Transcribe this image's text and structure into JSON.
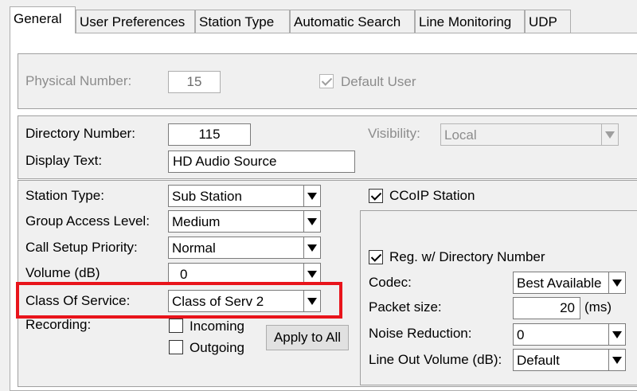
{
  "tabs": [
    "General",
    "User Preferences",
    "Station Type",
    "Automatic Search",
    "Line Monitoring",
    "UDP"
  ],
  "physical": {
    "label": "Physical Number:",
    "value": "15",
    "default_user_label": "Default User",
    "default_user_checked": true
  },
  "directory": {
    "number_label": "Directory Number:",
    "number_value": "115",
    "display_label": "Display Text:",
    "display_value": "HD Audio Source",
    "visibility_label": "Visibility:",
    "visibility_value": "Local"
  },
  "station": {
    "station_type_label": "Station Type:",
    "station_type_value": "Sub Station",
    "group_access_label": "Group Access Level:",
    "group_access_value": "Medium",
    "call_setup_label": "Call Setup Priority:",
    "call_setup_value": "Normal",
    "volume_label": "Volume (dB)",
    "volume_value": "0",
    "class_of_service_label": "Class Of Service:",
    "class_of_service_value": "Class of Serv 2",
    "recording_label": "Recording:",
    "incoming_label": "Incoming",
    "outgoing_label": "Outgoing",
    "incoming_checked": false,
    "outgoing_checked": false,
    "apply_all_label": "Apply to All"
  },
  "ccoip": {
    "station_label": "CCoIP Station",
    "station_checked": true,
    "reg_label": "Reg. w/ Directory Number",
    "reg_checked": true,
    "codec_label": "Codec:",
    "codec_value": "Best Available",
    "packet_label": "Packet size:",
    "packet_value": "20",
    "packet_unit": "(ms)",
    "noise_label": "Noise Reduction:",
    "noise_value": "0",
    "line_out_label": "Line Out Volume (dB):",
    "line_out_value": "Default"
  },
  "colors": {
    "highlight": "#e8141b",
    "disabled_text": "#8c8c8c"
  }
}
